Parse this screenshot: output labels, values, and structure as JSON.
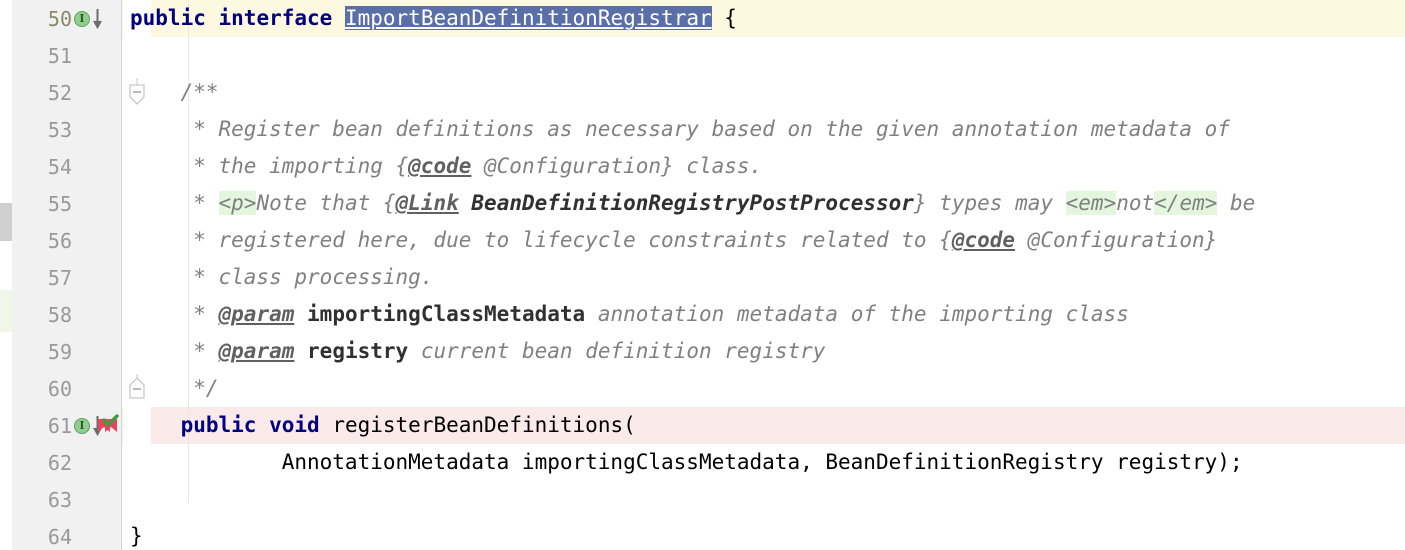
{
  "editor": {
    "language": "java",
    "colors": {
      "gutter_bg": "#f1f1f1",
      "current_line_bg": "#fdf8e0",
      "modified_line_bg": "#fbeaea",
      "selection_bg": "#5a6fa8",
      "keyword": "#000080",
      "javadoc": "#808080",
      "javadoc_html_bg": "#e5f6df",
      "indent_guide": "#e8e8e8",
      "edge_marker": "#cfcfcf"
    },
    "lines": [
      {
        "number": "50",
        "highlight": "current",
        "gutter_icons": [
          "implemented-icon"
        ],
        "fold": "none",
        "tokens": [
          {
            "text": "public",
            "type": "kw"
          },
          {
            "text": " ",
            "type": "plain"
          },
          {
            "text": "interface",
            "type": "kw"
          },
          {
            "text": " ",
            "type": "plain"
          },
          {
            "text": "ImportBeanDefinitionRegistrar",
            "type": "sel"
          },
          {
            "text": " {",
            "type": "plain"
          }
        ]
      },
      {
        "number": "51",
        "highlight": "none",
        "gutter_icons": [],
        "fold": "none",
        "tokens": []
      },
      {
        "number": "52",
        "highlight": "none",
        "gutter_icons": [],
        "fold": "start",
        "tokens": [
          {
            "text": "    /**",
            "type": "doc"
          }
        ]
      },
      {
        "number": "53",
        "highlight": "none",
        "gutter_icons": [],
        "fold": "none",
        "tokens": [
          {
            "text": "     * Register bean definitions as necessary based on the given annotation metadata of",
            "type": "doc"
          }
        ]
      },
      {
        "number": "54",
        "highlight": "none",
        "gutter_icons": [],
        "fold": "none",
        "tokens": [
          {
            "text": "     * the importing {",
            "type": "doc"
          },
          {
            "text": "@code",
            "type": "doc-tag"
          },
          {
            "text": " @Configuration} class.",
            "type": "doc"
          }
        ]
      },
      {
        "number": "55",
        "highlight": "none",
        "gutter_icons": [],
        "fold": "none",
        "tokens": [
          {
            "text": "     * ",
            "type": "doc"
          },
          {
            "text": "<p>",
            "type": "doc-html"
          },
          {
            "text": "Note that {",
            "type": "doc"
          },
          {
            "text": "@Link",
            "type": "doc-tag"
          },
          {
            "text": " ",
            "type": "doc"
          },
          {
            "text": "BeanDefinitionRegistryPostProcessor",
            "type": "doc-link-ref"
          },
          {
            "text": "} types may ",
            "type": "doc"
          },
          {
            "text": "<em>",
            "type": "doc-html"
          },
          {
            "text": "not",
            "type": "doc"
          },
          {
            "text": "</em>",
            "type": "doc-html"
          },
          {
            "text": " be",
            "type": "doc"
          }
        ]
      },
      {
        "number": "56",
        "highlight": "none",
        "gutter_icons": [],
        "fold": "none",
        "tokens": [
          {
            "text": "     * registered here, due to lifecycle constraints related to {",
            "type": "doc"
          },
          {
            "text": "@code",
            "type": "doc-tag"
          },
          {
            "text": " @Configuration}",
            "type": "doc"
          }
        ]
      },
      {
        "number": "57",
        "highlight": "none",
        "gutter_icons": [],
        "fold": "none",
        "tokens": [
          {
            "text": "     * class processing.",
            "type": "doc"
          }
        ]
      },
      {
        "number": "58",
        "highlight": "none",
        "gutter_icons": [],
        "fold": "none",
        "tokens": [
          {
            "text": "     * ",
            "type": "doc"
          },
          {
            "text": "@param",
            "type": "doc-tag"
          },
          {
            "text": " ",
            "type": "doc"
          },
          {
            "text": "importingClassMetadata",
            "type": "doc-param"
          },
          {
            "text": " annotation metadata of the importing class",
            "type": "doc"
          }
        ]
      },
      {
        "number": "59",
        "highlight": "none",
        "gutter_icons": [],
        "fold": "none",
        "tokens": [
          {
            "text": "     * ",
            "type": "doc"
          },
          {
            "text": "@param",
            "type": "doc-tag"
          },
          {
            "text": " ",
            "type": "doc"
          },
          {
            "text": "registry",
            "type": "doc-param"
          },
          {
            "text": " current bean definition registry",
            "type": "doc"
          }
        ]
      },
      {
        "number": "60",
        "highlight": "none",
        "gutter_icons": [],
        "fold": "end",
        "tokens": [
          {
            "text": "     */",
            "type": "doc"
          }
        ]
      },
      {
        "number": "61",
        "highlight": "modified",
        "gutter_icons": [
          "implemented-icon",
          "verified-bookmark-icon"
        ],
        "fold": "none",
        "tokens": [
          {
            "text": "    ",
            "type": "plain"
          },
          {
            "text": "public",
            "type": "kw"
          },
          {
            "text": " ",
            "type": "plain"
          },
          {
            "text": "void",
            "type": "kw"
          },
          {
            "text": " registerBeanDefinitions(",
            "type": "plain"
          }
        ]
      },
      {
        "number": "62",
        "highlight": "none",
        "gutter_icons": [],
        "fold": "none",
        "tokens": [
          {
            "text": "            AnnotationMetadata importingClassMetadata, BeanDefinitionRegistry registry);",
            "type": "plain"
          }
        ]
      },
      {
        "number": "63",
        "highlight": "none",
        "gutter_icons": [],
        "fold": "none",
        "tokens": []
      },
      {
        "number": "64",
        "highlight": "none",
        "gutter_icons": [],
        "fold": "none",
        "tokens": [
          {
            "text": "}",
            "type": "plain"
          }
        ]
      }
    ]
  }
}
